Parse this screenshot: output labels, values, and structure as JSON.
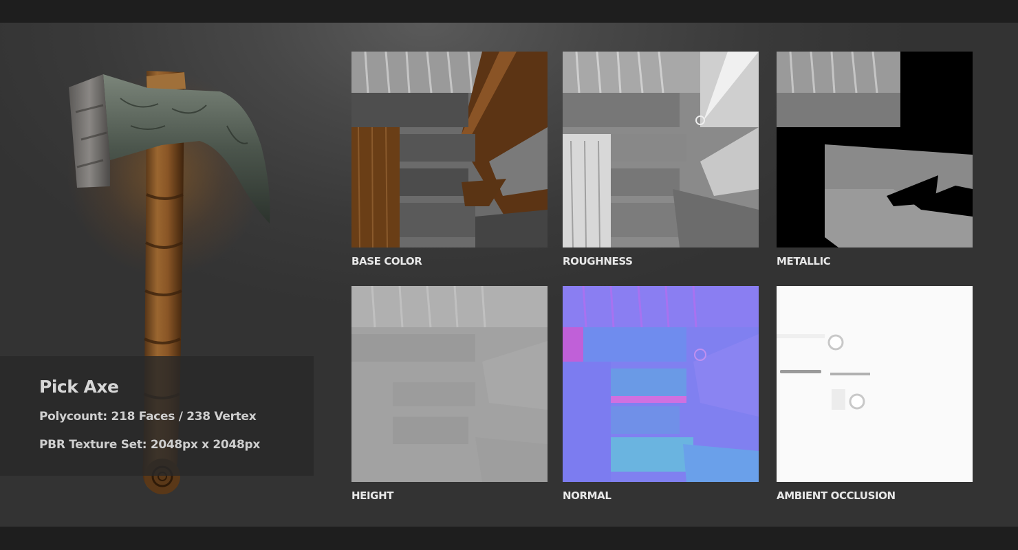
{
  "model": {
    "title": "Pick Axe",
    "polycount": "Polycount: 218 Faces / 238 Vertex",
    "texture_set": "PBR Texture Set: 2048px x 2048px"
  },
  "maps": [
    {
      "label": "BASE COLOR"
    },
    {
      "label": "ROUGHNESS"
    },
    {
      "label": "METALLIC"
    },
    {
      "label": "HEIGHT"
    },
    {
      "label": "NORMAL"
    },
    {
      "label": "AMBIENT OCCLUSION"
    }
  ],
  "colors": {
    "background": "#3a3a3a",
    "frame": "#1e1e1e",
    "label": "#e8e8e8",
    "handle_wood": "#8a5a2b",
    "axe_head_stone": "#4f5a50"
  }
}
